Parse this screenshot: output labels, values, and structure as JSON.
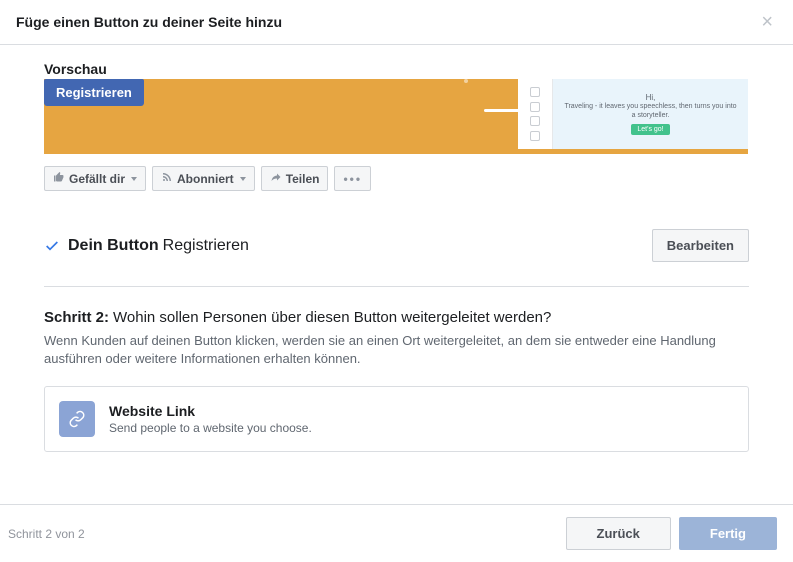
{
  "header": {
    "title": "Füge einen Button zu deiner Seite hinzu"
  },
  "preview": {
    "label": "Vorschau",
    "cta_label": "Registrieren",
    "mockup": {
      "hi": "Hi,",
      "tagline": "Traveling - it leaves you speechless, then turns you into a storyteller.",
      "mini_btn": "Let's go!"
    }
  },
  "actions": {
    "like": "Gefällt dir",
    "subscribed": "Abonniert",
    "share": "Teilen"
  },
  "confirm": {
    "label": "Dein Button",
    "value": "Registrieren",
    "edit": "Bearbeiten"
  },
  "step2": {
    "title_bold": "Schritt 2:",
    "title_rest": "Wohin sollen Personen über diesen Button weitergeleitet werden?",
    "desc": "Wenn Kunden auf deinen Button klicken, werden sie an einen Ort weitergeleitet, an dem sie entweder eine Handlung ausführen oder weitere Informationen erhalten können.",
    "option": {
      "title": "Website Link",
      "desc": "Send people to a website you choose."
    }
  },
  "footer": {
    "step_indicator": "Schritt 2 von 2",
    "back": "Zurück",
    "done": "Fertig"
  }
}
